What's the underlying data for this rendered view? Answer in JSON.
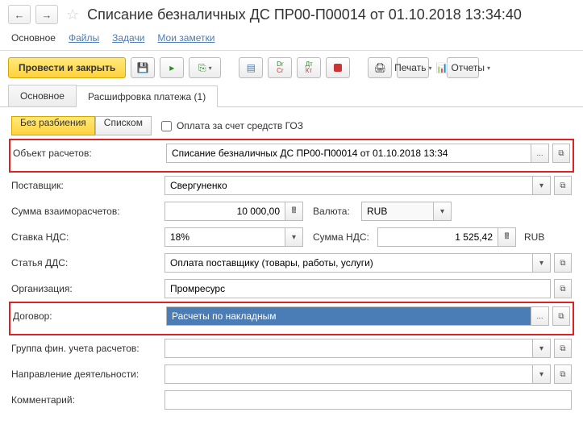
{
  "header": {
    "title": "Списание безналичных ДС ПР00-П00014 от 01.10.2018 13:34:40"
  },
  "topTabs": {
    "main": "Основное",
    "files": "Файлы",
    "tasks": "Задачи",
    "notes": "Мои заметки"
  },
  "toolbar": {
    "submit": "Провести и закрыть",
    "print": "Печать",
    "reports": "Отчеты"
  },
  "subTabs": {
    "main": "Основное",
    "details": "Расшифровка платежа (1)"
  },
  "mode": {
    "noSplit": "Без разбиения",
    "list": "Списком"
  },
  "gozCheckbox": "Оплата за счет средств ГОЗ",
  "fields": {
    "object_label": "Объект расчетов:",
    "object_value": "Списание безналичных ДС ПР00-П00014 от 01.10.2018 13:34",
    "supplier_label": "Поставщик:",
    "supplier_value": "Свергуненко",
    "amount_label": "Сумма взаиморасчетов:",
    "amount_value": "10 000,00",
    "currency_label": "Валюта:",
    "currency_value": "RUB",
    "vat_rate_label": "Ставка НДС:",
    "vat_rate_value": "18%",
    "vat_amount_label": "Сумма НДС:",
    "vat_amount_value": "1 525,42",
    "vat_currency": "RUB",
    "dds_label": "Статья ДДС:",
    "dds_value": "Оплата поставщику (товары, работы, услуги)",
    "org_label": "Организация:",
    "org_value": "Промресурс",
    "contract_label": "Договор:",
    "contract_value": "Расчеты по накладным",
    "fingroup_label": "Группа фин. учета расчетов:",
    "fingroup_value": "",
    "activity_label": "Направление деятельности:",
    "activity_value": "",
    "comment_label": "Комментарий:",
    "comment_value": ""
  }
}
